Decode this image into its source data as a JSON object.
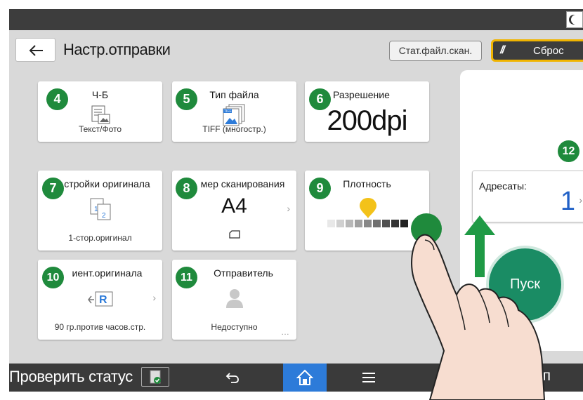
{
  "header": {
    "title": "Настр.отправки",
    "stat_button": "Стат.файл.скан.",
    "reset_button": "Сброс"
  },
  "tiles": [
    {
      "badge": "4",
      "title": "Ч-Б",
      "subtitle": "Текст/Фото",
      "icon": "text-photo-icon"
    },
    {
      "badge": "5",
      "title": "Тип файла",
      "subtitle": "TIFF (многостр.)",
      "icon": "tiff-multipage-icon"
    },
    {
      "badge": "6",
      "title": "Разрешение",
      "value": "200dpi"
    },
    {
      "badge": "7",
      "title": "стройки оригинала",
      "subtitle": "1-стор.оригинал",
      "icon": "one-sided-original-icon"
    },
    {
      "badge": "8",
      "title": "мер сканирования",
      "value": "A4",
      "icon": "paper-orientation-icon"
    },
    {
      "badge": "9",
      "title": "Плотность",
      "density_level": 0.5,
      "icon": "density-scale-icon"
    },
    {
      "badge": "10",
      "title": "иент.оригинала",
      "subtitle": "90 гр.против часов.стр.",
      "icon": "rotate-original-icon"
    },
    {
      "badge": "11",
      "title": "Отправитель",
      "subtitle": "Недоступно",
      "icon": "person-icon"
    }
  ],
  "destinations": {
    "badge": "12",
    "label": "Адресаты:",
    "count": "1"
  },
  "start_button": "Пуск",
  "navbar": {
    "status": "Проверить статус",
    "right_partial": "оп"
  },
  "colors": {
    "badge_green": "#1f8a3c",
    "start_green": "#1a8c64",
    "accent_yellow": "#f0b400",
    "home_blue": "#2d7bd9",
    "count_blue": "#2161c7"
  }
}
